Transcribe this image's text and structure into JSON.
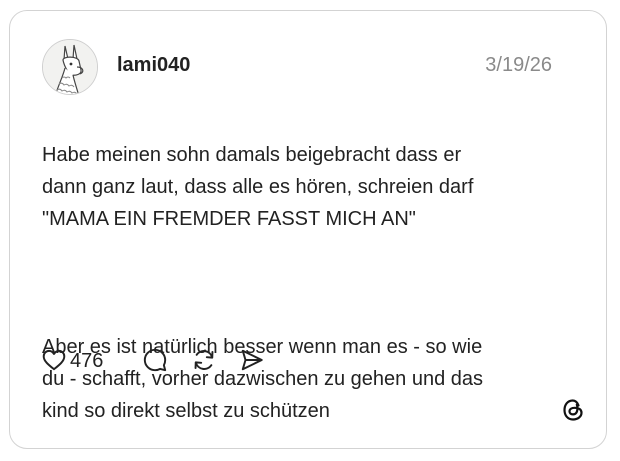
{
  "post": {
    "username": "lami040",
    "date": "3/19/26",
    "paragraph1": "Habe meinen sohn damals beigebracht dass er\ndann ganz laut, dass alle es hören, schreien darf\n\"MAMA EIN FREMDER FASST MICH AN\"",
    "paragraph2": "Aber es ist natürlich besser wenn man es - so wie\ndu - schafft, vorher dazwischen zu gehen und das\nkind so direkt selbst zu schützen"
  },
  "actions": {
    "like_count": "476",
    "icons": [
      "heart-icon",
      "comment-icon",
      "repost-icon",
      "share-icon"
    ]
  },
  "branding": {
    "logo": "threads-logo-icon"
  }
}
